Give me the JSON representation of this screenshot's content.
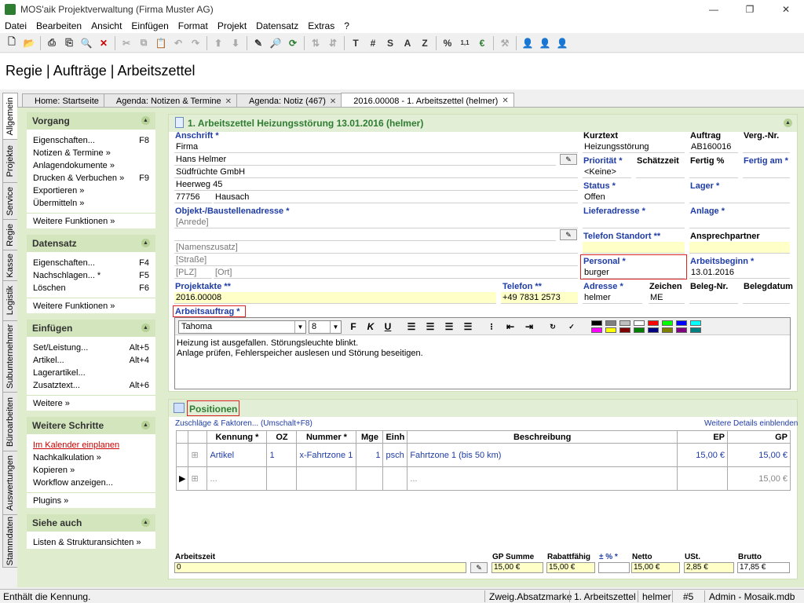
{
  "window": {
    "title": "MOS'aik Projektverwaltung (Firma Muster AG)"
  },
  "menu": [
    "Datei",
    "Bearbeiten",
    "Ansicht",
    "Einfügen",
    "Format",
    "Projekt",
    "Datensatz",
    "Extras",
    "?"
  ],
  "toolbar_letters": [
    "T",
    "#",
    "S",
    "A",
    "Z",
    "%"
  ],
  "breadcrumb": "Regie | Aufträge | Arbeitszettel",
  "tabs": [
    {
      "label": "Home: Startseite"
    },
    {
      "label": "Agenda: Notizen & Termine"
    },
    {
      "label": "Agenda: Notiz (467)"
    },
    {
      "label": "2016.00008 - 1. Arbeitszettel (helmer)"
    }
  ],
  "vtabs": [
    "Allgemein",
    "Projekte",
    "Service",
    "Regie",
    "Kasse",
    "Logistik",
    "Subunternehmer",
    "Büroarbeiten",
    "Auswertungen",
    "Stammdaten"
  ],
  "sidebar": {
    "vorgang": {
      "title": "Vorgang",
      "items": [
        {
          "label": "Eigenschaften...",
          "key": "F8"
        },
        {
          "label": "Notizen & Termine »",
          "key": ""
        },
        {
          "label": "Anlagendokumente »",
          "key": ""
        },
        {
          "label": "Drucken & Verbuchen »",
          "key": "F9"
        },
        {
          "label": "Exportieren »",
          "key": ""
        },
        {
          "label": "Übermitteln »",
          "key": ""
        }
      ],
      "more": "Weitere Funktionen »"
    },
    "datensatz": {
      "title": "Datensatz",
      "items": [
        {
          "label": "Eigenschaften...",
          "key": "F4"
        },
        {
          "label": "Nachschlagen... *",
          "key": "F5"
        },
        {
          "label": "Löschen",
          "key": "F6"
        }
      ],
      "more": "Weitere Funktionen »"
    },
    "einfuegen": {
      "title": "Einfügen",
      "items": [
        {
          "label": "Set/Leistung...",
          "key": "Alt+5"
        },
        {
          "label": "Artikel...",
          "key": "Alt+4"
        },
        {
          "label": "Lagerartikel...",
          "key": ""
        },
        {
          "label": "Zusatztext...",
          "key": "Alt+6"
        }
      ],
      "more": "Weitere »"
    },
    "schritte": {
      "title": "Weitere Schritte",
      "items": [
        {
          "label": "Im Kalender einplanen",
          "key": ""
        },
        {
          "label": "Nachkalkulation »",
          "key": ""
        },
        {
          "label": "Kopieren »",
          "key": ""
        },
        {
          "label": "Workflow anzeigen...",
          "key": ""
        }
      ],
      "more": "Plugins »"
    },
    "siehe": {
      "title": "Siehe auch",
      "items": [
        {
          "label": "Listen & Strukturansichten »",
          "key": ""
        }
      ]
    }
  },
  "form": {
    "title": "1. Arbeitszettel Heizungsstörung 13.01.2016 (helmer)",
    "anschrift_label": "Anschrift *",
    "anschrift": [
      "Firma",
      "Hans Helmer",
      "Südfrüchte GmbH",
      "Heerweg 45"
    ],
    "plz": "77756",
    "ort": "Hausach",
    "objekt_label": "Objekt-/Baustellenadresse *",
    "objekt": [
      "[Anrede]",
      "",
      "[Namenszusatz]",
      "[Straße]"
    ],
    "objekt_plz": "[PLZ]",
    "objekt_ort": "[Ort]",
    "projektakte_label": "Projektakte **",
    "projektakte": "2016.00008",
    "telefon_label": "Telefon **",
    "telefon": "+49 7831 2573",
    "kurztext_label": "Kurztext",
    "kurztext": "Heizungsstörung",
    "auftrag_label": "Auftrag",
    "auftrag": "AB160016",
    "vergnr_label": "Verg.-Nr.",
    "vergnr": "",
    "prioritaet_label": "Priorität *",
    "prioritaet": "<Keine>",
    "schaetzzeit_label": "Schätzzeit",
    "fertig_label": "Fertig %",
    "fertigam_label": "Fertig am *",
    "status_label": "Status *",
    "status": "Offen",
    "lager_label": "Lager *",
    "lieferadresse_label": "Lieferadresse *",
    "anlage_label": "Anlage *",
    "telstandort_label": "Telefon Standort **",
    "ansprech_label": "Ansprechpartner",
    "personal_label": "Personal *",
    "personal": "burger",
    "arbeitsbeginn_label": "Arbeitsbeginn *",
    "arbeitsbeginn": "13.01.2016",
    "adresse_label": "Adresse *",
    "adresse": "helmer",
    "zeichen_label": "Zeichen",
    "zeichen": "ME",
    "belegnr_label": "Beleg-Nr.",
    "belegdatum_label": "Belegdatum",
    "arbeitsauftrag_label": "Arbeitsauftrag *",
    "font": "Tahoma",
    "size": "8",
    "text": [
      "Heizung ist ausgefallen. Störungsleuchte blinkt.",
      "Anlage prüfen, Fehlerspeicher auslesen und Störung beseitigen."
    ],
    "colors": [
      "#000000",
      "#808080",
      "#c0c0c0",
      "#ffffff",
      "#ff0000",
      "#00ff00",
      "#0000ff",
      "#00ffff",
      "#ff00ff",
      "#ffff00",
      "#800000",
      "#008000",
      "#000080",
      "#808000",
      "#800080",
      "#008080"
    ]
  },
  "positionen": {
    "title": "Positionen",
    "zuschlaege": "Zuschläge & Faktoren... (Umschalt+F8)",
    "details": "Weitere Details einblenden",
    "headers": [
      "Kennung *",
      "OZ",
      "Nummer *",
      "Mge",
      "Einh",
      "Beschreibung",
      "EP",
      "GP"
    ],
    "row1": {
      "kennung": "Artikel",
      "oz": "1",
      "nummer": "x-Fahrtzone 1",
      "mge": "1",
      "einh": "psch",
      "beschreibung": "Fahrtzone 1 (bis 50 km)",
      "ep": "15,00 €",
      "gp": "15,00 €"
    },
    "row2": {
      "kennung": "...",
      "beschreibung": "...",
      "gp": "15,00 €"
    }
  },
  "totals": {
    "arbeitszeit_label": "Arbeitszeit",
    "arbeitszeit": "0",
    "gpsumme_label": "GP Summe",
    "gpsumme": "15,00 €",
    "rabatt_label": "Rabattfähig",
    "rabatt": "15,00 €",
    "proz_label": "± % *",
    "proz": "",
    "netto_label": "Netto",
    "netto": "15,00 €",
    "ust_label": "USt.",
    "ust": "2,85 €",
    "brutto_label": "Brutto",
    "brutto": "17,85 €"
  },
  "status": {
    "message": "Enthält die Kennung.",
    "cells": [
      "Zweig.Absatzmarke",
      "1. Arbeitszettel",
      "helmer",
      "#5",
      "Admin - Mosaik.mdb"
    ]
  }
}
